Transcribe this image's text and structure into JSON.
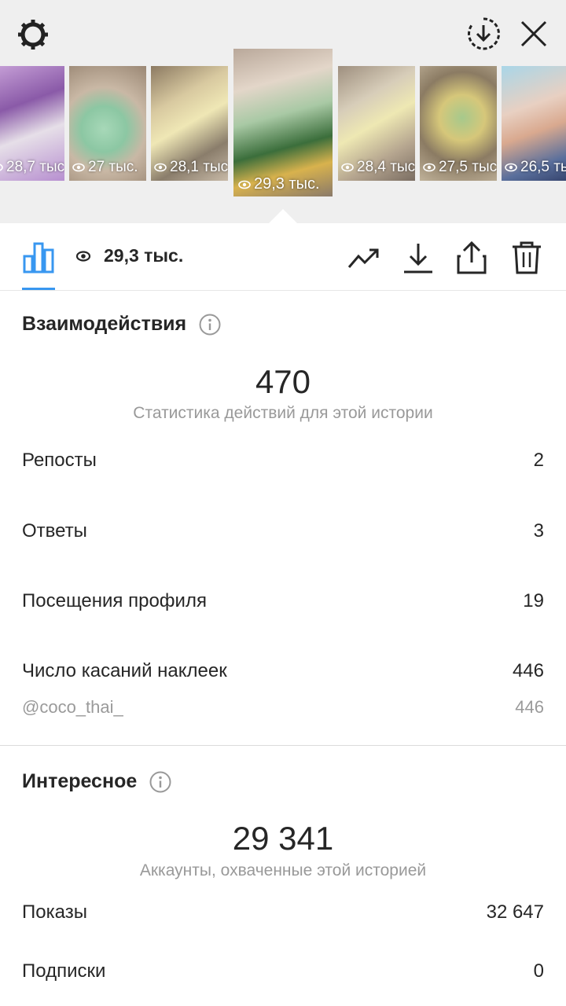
{
  "top_bar": {
    "settings_icon": "gear-icon",
    "download_icon": "circle-download-icon",
    "close_icon": "close-icon"
  },
  "stories": [
    {
      "views": "28,7 тыс."
    },
    {
      "views": "27 тыс."
    },
    {
      "views": "28,1 тыс."
    },
    {
      "views": "29,3 тыс.",
      "active": true
    },
    {
      "views": "28,4 тыс."
    },
    {
      "views": "27,5 тыс."
    },
    {
      "views": "26,5 тыс."
    }
  ],
  "toolbar": {
    "views_total": "29,3 тыс.",
    "icons": [
      "bar-chart-icon",
      "eye-icon",
      "trending-icon",
      "download-icon",
      "share-icon",
      "trash-icon"
    ]
  },
  "interactions": {
    "title": "Взаимодействия",
    "total": "470",
    "subtitle": "Статистика действий для этой истории",
    "rows": [
      {
        "label": "Репосты",
        "value": "2"
      },
      {
        "label": "Ответы",
        "value": "3"
      },
      {
        "label": "Посещения профиля",
        "value": "19"
      },
      {
        "label": "Число касаний наклеек",
        "value": "446"
      }
    ],
    "sticker": {
      "label": "@coco_thai_",
      "value": "446"
    }
  },
  "discovery": {
    "title": "Интересное",
    "total": "29 341",
    "subtitle": "Аккаунты, охваченные этой историей",
    "rows": [
      {
        "label": "Показы",
        "value": "32 647"
      },
      {
        "label": "Подписки",
        "value": "0"
      }
    ]
  },
  "colors": {
    "accent": "#3897f0",
    "text": "#262626",
    "muted": "#999999"
  }
}
